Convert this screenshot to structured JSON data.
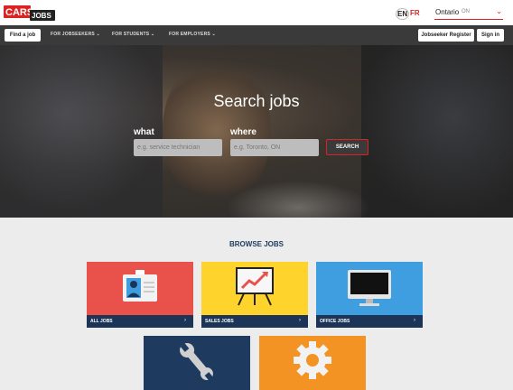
{
  "header": {
    "logo_text_1": "CARS",
    "logo_text_2": "JOBS",
    "lang_en": "EN",
    "lang_fr": "FR",
    "region_name": "Ontario",
    "region_code": "ON"
  },
  "nav": {
    "find_job": "Find a job",
    "jobseekers": "FOR JOBSEEKERS",
    "students": "FOR STUDENTS",
    "employers": "FOR EMPLOYERS",
    "register": "Jobseeker Register",
    "sign_in": "Sign in"
  },
  "hero": {
    "title": "Search jobs",
    "what_label": "what",
    "where_label": "where",
    "what_placeholder": "e.g. service technician",
    "where_placeholder": "e.g. Toronto, ON",
    "search_label": "SEARCH"
  },
  "browse": {
    "title": "BROWSE JOBS",
    "tiles": [
      {
        "label": "ALL JOBS",
        "color": "#e8524a"
      },
      {
        "label": "SALES JOBS",
        "color": "#fdd32c"
      },
      {
        "label": "OFFICE JOBS",
        "color": "#3f9ee0"
      },
      {
        "label": "",
        "color": "#1f3a5f"
      },
      {
        "label": "",
        "color": "#f39324"
      }
    ]
  },
  "colors": {
    "brand_red": "#d22222",
    "navy": "#1c3557",
    "nav_bg": "#3a3a3a"
  }
}
